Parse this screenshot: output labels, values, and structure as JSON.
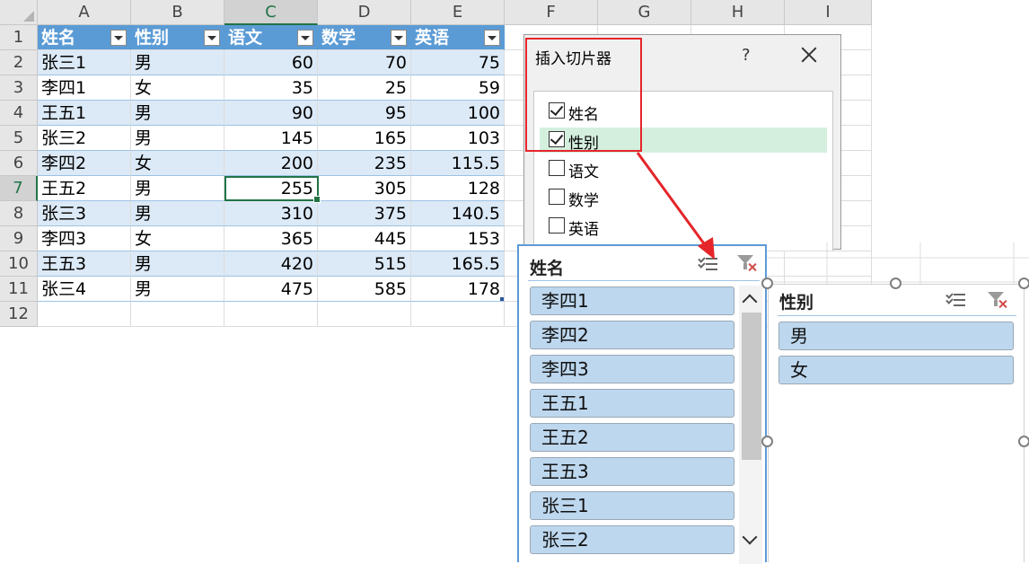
{
  "columns": [
    "A",
    "B",
    "C",
    "D",
    "E",
    "F",
    "G",
    "H",
    "I"
  ],
  "rows": [
    "1",
    "2",
    "3",
    "4",
    "5",
    "6",
    "7",
    "8",
    "9",
    "10",
    "11",
    "12"
  ],
  "table": {
    "headers": [
      "姓名",
      "性别",
      "语文",
      "数学",
      "英语"
    ],
    "data": [
      [
        "张三1",
        "男",
        "60",
        "70",
        "75"
      ],
      [
        "李四1",
        "女",
        "35",
        "25",
        "59"
      ],
      [
        "王五1",
        "男",
        "90",
        "95",
        "100"
      ],
      [
        "张三2",
        "男",
        "145",
        "165",
        "103"
      ],
      [
        "李四2",
        "女",
        "200",
        "235",
        "115.5"
      ],
      [
        "王五2",
        "男",
        "255",
        "305",
        "128"
      ],
      [
        "张三3",
        "男",
        "310",
        "375",
        "140.5"
      ],
      [
        "李四3",
        "女",
        "365",
        "445",
        "153"
      ],
      [
        "王五3",
        "男",
        "420",
        "515",
        "165.5"
      ],
      [
        "张三4",
        "男",
        "475",
        "585",
        "178"
      ]
    ]
  },
  "active_cell": "C7",
  "dialog": {
    "title": "插入切片器",
    "help": "?",
    "fields": [
      {
        "label": "姓名",
        "checked": true
      },
      {
        "label": "性别",
        "checked": true
      },
      {
        "label": "语文",
        "checked": false
      },
      {
        "label": "数学",
        "checked": false
      },
      {
        "label": "英语",
        "checked": false
      }
    ]
  },
  "slicer_name": {
    "title": "姓名",
    "items": [
      "李四1",
      "李四2",
      "李四3",
      "王五1",
      "王五2",
      "王五3",
      "张三1",
      "张三2"
    ]
  },
  "slicer_gender": {
    "title": "性别",
    "items": [
      "男",
      "女"
    ]
  },
  "colors": {
    "header_fill": "#5b9bd5",
    "band_fill": "#dce9f6",
    "slicer_item": "#bdd7ee",
    "annotation_red": "#e5252a",
    "excel_green": "#217346"
  }
}
